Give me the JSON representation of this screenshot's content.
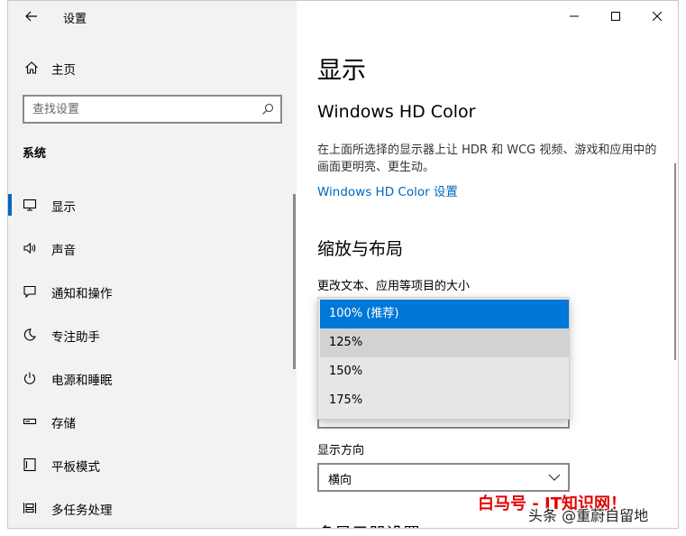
{
  "window": {
    "title": "设置"
  },
  "sidebar": {
    "home_label": "主页",
    "search_placeholder": "查找设置",
    "section_label": "系统",
    "items": [
      {
        "label": "显示",
        "icon": "monitor-icon",
        "selected": true
      },
      {
        "label": "声音",
        "icon": "speaker-icon"
      },
      {
        "label": "通知和操作",
        "icon": "notification-icon"
      },
      {
        "label": "专注助手",
        "icon": "moon-icon"
      },
      {
        "label": "电源和睡眠",
        "icon": "power-icon"
      },
      {
        "label": "存储",
        "icon": "storage-icon"
      },
      {
        "label": "平板模式",
        "icon": "tablet-icon"
      },
      {
        "label": "多任务处理",
        "icon": "multitask-icon"
      }
    ]
  },
  "main": {
    "page_title": "显示",
    "hdr_heading": "Windows HD Color",
    "hdr_description": "在上面所选择的显示器上让 HDR 和 WCG 视频、游戏和应用中的画面更明亮、更生动。",
    "hdr_link": "Windows HD Color 设置",
    "scale_heading": "缩放与布局",
    "scale_label": "更改文本、应用等项目的大小",
    "scale_options": [
      "100% (推荐)",
      "125%",
      "150%",
      "175%"
    ],
    "scale_selected": "100% (推荐)",
    "orientation_label": "显示方向",
    "orientation_value": "横向",
    "next_heading": "多显示器设置"
  },
  "watermark": {
    "red_text": "白马号 - IT知识网！",
    "source_text": "头条 @重蔚自留地"
  },
  "colors": {
    "accent": "#0067c0",
    "dropdown_selected": "#0078d7",
    "watermark_red": "#e60000"
  }
}
